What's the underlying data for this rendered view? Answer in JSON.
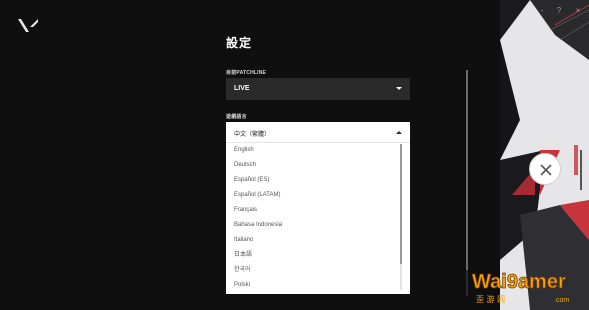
{
  "header": {
    "logo_icon": "valorant-logo-icon",
    "title": "設定"
  },
  "window_controls": {
    "minimize": "-",
    "help": "?",
    "close": "×"
  },
  "patchline": {
    "label": "目前PATCHLINE",
    "value": "LIVE"
  },
  "language": {
    "label": "遊戲語言",
    "selected": "中文（繁體）",
    "options": [
      "English",
      "Deutsch",
      "Español (ES)",
      "Español (LATAM)",
      "Français",
      "Bahasa Indonesia",
      "Italiano",
      "日本語",
      "한국어",
      "Polski"
    ]
  },
  "close_settings_icon": "close-icon",
  "colors": {
    "background": "#0f0f10",
    "select_bg": "#2a2a2b",
    "accent_red": "#c8343b",
    "art_panel": "#e6e6e8"
  }
}
